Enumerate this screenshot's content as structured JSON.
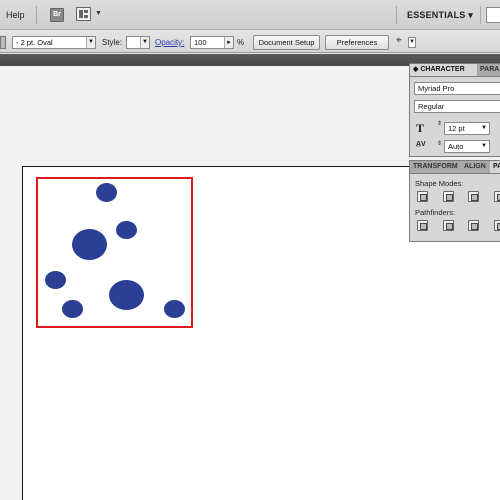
{
  "menubar": {
    "help_label": "Help",
    "bridge_label": "Br",
    "workspace_label": "ESSENTIALS ▾"
  },
  "controlbar": {
    "brush_value": "- 2 pt. Oval",
    "style_label": "Style:",
    "opacity_label": "Opacity:",
    "opacity_value": "100",
    "opacity_unit": "%",
    "document_setup_label": "Document Setup",
    "preferences_label": "Preferences"
  },
  "character_panel": {
    "tab_character": "◆ CHARACTER",
    "tab_paragraph": "PARA",
    "font_family": "Myriad Pro",
    "font_style": "Regular",
    "font_size": "12 pt",
    "leading": "Auto"
  },
  "pathfinder_panel": {
    "tab_transform": "TRANSFORM",
    "tab_align": "ALIGN",
    "tab_pathfinder": "PA",
    "shape_modes_label": "Shape Modes:",
    "pathfinders_label": "Pathfinders:"
  },
  "colors": {
    "dot_fill": "#2b3f94",
    "selection_stroke": "#e0191f"
  }
}
